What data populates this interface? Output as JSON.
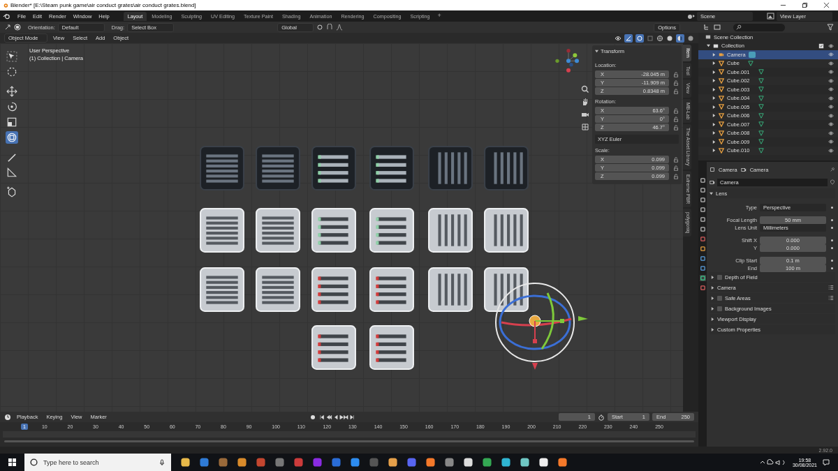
{
  "window": {
    "title": "Blender* [E:\\Steam punk game\\air conduct grates\\air conduct grates.blend]"
  },
  "menu": [
    "File",
    "Edit",
    "Render",
    "Window",
    "Help"
  ],
  "workspaces": [
    {
      "label": "Layout",
      "selected": true
    },
    {
      "label": "Modeling",
      "selected": false
    },
    {
      "label": "Sculpting",
      "selected": false
    },
    {
      "label": "UV Editing",
      "selected": false
    },
    {
      "label": "Texture Paint",
      "selected": false
    },
    {
      "label": "Shading",
      "selected": false
    },
    {
      "label": "Animation",
      "selected": false
    },
    {
      "label": "Rendering",
      "selected": false
    },
    {
      "label": "Compositing",
      "selected": false
    },
    {
      "label": "Scripting",
      "selected": false
    }
  ],
  "add_workspace": "+",
  "scene": "Scene",
  "view_layer": "View Layer",
  "tool_header": {
    "orientation_label": "Orientation:",
    "orientation": "Default",
    "drag_label": "Drag:",
    "drag": "Select Box",
    "transform_orientation": "Global",
    "options": "Options"
  },
  "viewport_header": {
    "mode": "Object Mode",
    "menus": [
      "View",
      "Select",
      "Add",
      "Object"
    ]
  },
  "viewport": {
    "view_name": "User Perspective",
    "context": "(1) Collection | Camera"
  },
  "transform": {
    "title": "Transform",
    "location_label": "Location:",
    "location": [
      {
        "axis": "X",
        "value": "-28.045 m"
      },
      {
        "axis": "Y",
        "value": "-11.909 m"
      },
      {
        "axis": "Z",
        "value": "0.8348 m"
      }
    ],
    "rotation_label": "Rotation:",
    "rotation": [
      {
        "axis": "X",
        "value": "63.6°"
      },
      {
        "axis": "Y",
        "value": "0°"
      },
      {
        "axis": "Z",
        "value": "46.7°"
      }
    ],
    "rotation_mode": "XYZ Euler",
    "scale_label": "Scale:",
    "scale": [
      {
        "axis": "X",
        "value": "0.099"
      },
      {
        "axis": "Y",
        "value": "0.099"
      },
      {
        "axis": "Z",
        "value": "0.099"
      }
    ]
  },
  "sidebar_tabs": [
    {
      "label": "Item",
      "selected": true
    },
    {
      "label": "Tool",
      "selected": false
    },
    {
      "label": "View",
      "selected": false
    },
    {
      "label": "MB-Lab",
      "selected": false
    },
    {
      "label": "The Asset Library",
      "selected": false
    },
    {
      "label": "Extreme PBR",
      "selected": false
    },
    {
      "label": "polygoniq",
      "selected": false
    }
  ],
  "outliner": {
    "root": "Scene Collection",
    "items": [
      {
        "name": "Collection",
        "kind": "collection",
        "expanded": true,
        "selected": false,
        "children": [
          {
            "name": "Camera",
            "kind": "camera",
            "selected": true
          },
          {
            "name": "Cube",
            "kind": "mesh",
            "selected": false
          },
          {
            "name": "Cube.001",
            "kind": "mesh",
            "selected": false
          },
          {
            "name": "Cube.002",
            "kind": "mesh",
            "selected": false
          },
          {
            "name": "Cube.003",
            "kind": "mesh",
            "selected": false
          },
          {
            "name": "Cube.004",
            "kind": "mesh",
            "selected": false
          },
          {
            "name": "Cube.005",
            "kind": "mesh",
            "selected": false
          },
          {
            "name": "Cube.006",
            "kind": "mesh",
            "selected": false
          },
          {
            "name": "Cube.007",
            "kind": "mesh",
            "selected": false
          },
          {
            "name": "Cube.008",
            "kind": "mesh",
            "selected": false
          },
          {
            "name": "Cube.009",
            "kind": "mesh",
            "selected": false
          },
          {
            "name": "Cube.010",
            "kind": "mesh",
            "selected": false
          }
        ]
      }
    ]
  },
  "properties": {
    "breadcrumb": [
      "Camera",
      "Camera"
    ],
    "datablock": "Camera",
    "panel": "Lens",
    "field_groups": [
      [
        {
          "label": "Type",
          "value": "Perspective",
          "kind": "dropdown"
        }
      ],
      [
        {
          "label": "Focal Length",
          "value": "50 mm",
          "kind": "number"
        },
        {
          "label": "Lens Unit",
          "value": "Millimeters",
          "kind": "dropdown"
        }
      ],
      [
        {
          "label": "Shift X",
          "value": "0.000",
          "kind": "number"
        },
        {
          "label": "Y",
          "value": "0.000",
          "kind": "number"
        }
      ],
      [
        {
          "label": "Clip Start",
          "value": "0.1 m",
          "kind": "number"
        },
        {
          "label": "End",
          "value": "100 m",
          "kind": "number"
        }
      ]
    ],
    "subpanels": [
      {
        "label": "Depth of Field",
        "kind": "checkbox",
        "checked": false,
        "presets": false
      },
      {
        "label": "Camera",
        "kind": "plain",
        "presets": true
      },
      {
        "label": "Safe Areas",
        "kind": "checkbox",
        "checked": false,
        "presets": true
      },
      {
        "label": "Background Images",
        "kind": "checkbox",
        "checked": false,
        "presets": false
      },
      {
        "label": "Viewport Display",
        "kind": "plain",
        "presets": false
      },
      {
        "label": "Custom Properties",
        "kind": "plain",
        "presets": false
      }
    ]
  },
  "timeline": {
    "menus": [
      "Playback",
      "Keying",
      "View",
      "Marker"
    ],
    "frame": "1",
    "start_label": "Start",
    "start": "1",
    "end_label": "End",
    "end": "250",
    "current": "1",
    "ticks": [
      "10",
      "20",
      "30",
      "40",
      "50",
      "60",
      "70",
      "80",
      "90",
      "100",
      "110",
      "120",
      "130",
      "140",
      "150",
      "160",
      "170",
      "180",
      "190",
      "200",
      "210",
      "220",
      "230",
      "240",
      "250"
    ]
  },
  "status_bar": {
    "version": "2.92.0"
  },
  "taskbar": {
    "search_placeholder": "Type here to search",
    "time": "19:58",
    "date": "30/08/2021"
  }
}
